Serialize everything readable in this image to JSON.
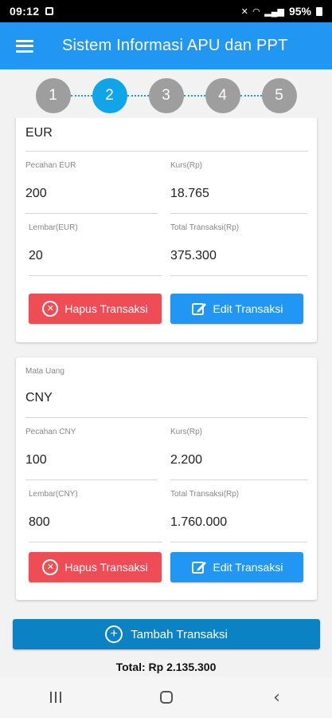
{
  "status_bar": {
    "time": "09:12",
    "battery": "95%"
  },
  "app_bar": {
    "title": "Sistem Informasi APU dan PPT"
  },
  "stepper": {
    "steps": [
      "1",
      "2",
      "3",
      "4",
      "5"
    ],
    "active": "2"
  },
  "transactions": [
    {
      "currency_label": "",
      "currency": "EUR",
      "denomination_label": "Pecahan EUR",
      "denomination": "200",
      "rate_label": "Kurs(Rp)",
      "rate": "18.765",
      "sheets_label": "Lembar(EUR)",
      "sheets": "20",
      "total_label": "Total Transaksi(Rp)",
      "total": "375.300",
      "delete_label": "Hapus Transaksi",
      "edit_label": "Edit Transaksi"
    },
    {
      "currency_label": "Mata Uang",
      "currency": "CNY",
      "denomination_label": "Pecahan CNY",
      "denomination": "100",
      "rate_label": "Kurs(Rp)",
      "rate": "2.200",
      "sheets_label": "Lembar(CNY)",
      "sheets": "800",
      "total_label": "Total Transaksi(Rp)",
      "total": "1.760.000",
      "delete_label": "Hapus Transaksi",
      "edit_label": "Edit Transaksi"
    }
  ],
  "add_button": {
    "label": "Tambah Transaksi"
  },
  "grand_total": "Total: Rp 2.135.300",
  "colors": {
    "primary": "#2196f3",
    "step_active": "#0ea5e9",
    "step_inactive": "#9e9e9e",
    "danger": "#ef4d55",
    "add_button": "#0b82c4"
  }
}
